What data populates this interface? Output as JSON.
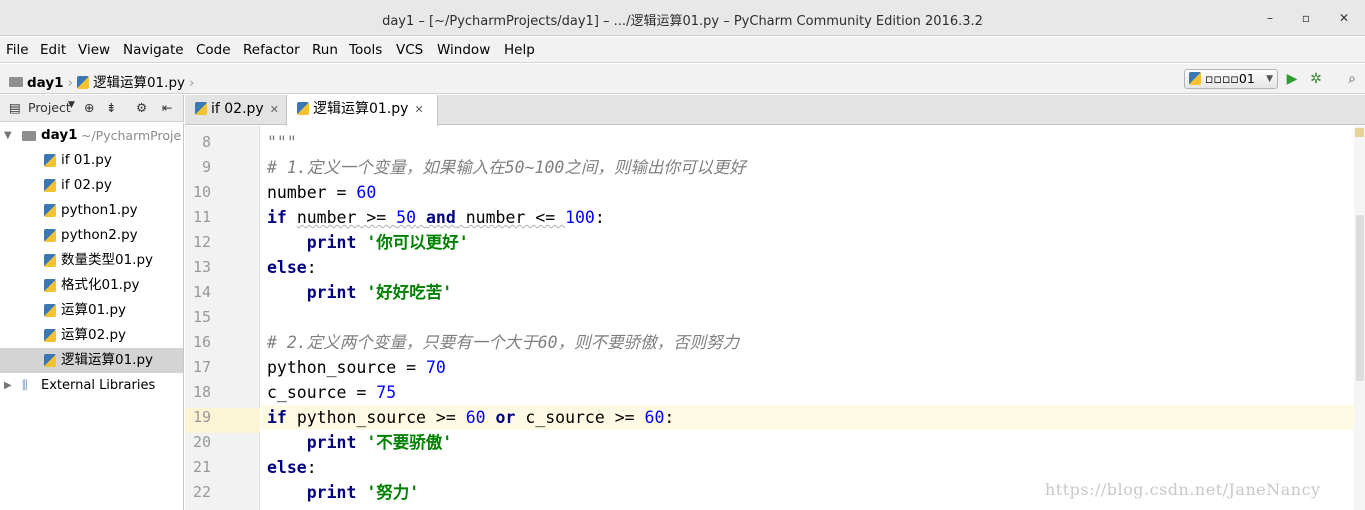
{
  "window": {
    "title": "day1 – [~/PycharmProjects/day1] – .../逻辑运算01.py – PyCharm Community Edition 2016.3.2",
    "minimize": "–",
    "maximize": "▫",
    "close": "✕"
  },
  "menu": [
    "File",
    "Edit",
    "View",
    "Navigate",
    "Code",
    "Refactor",
    "Run",
    "Tools",
    "VCS",
    "Window",
    "Help"
  ],
  "nav": {
    "project": "day1",
    "file": "逻辑运算01.py",
    "run_config": "▫▫▫▫01"
  },
  "project_panel": {
    "label": "Project",
    "root_name": "day1",
    "root_path": "~/PycharmProje",
    "files": [
      "if 01.py",
      "if 02.py",
      "python1.py",
      "python2.py",
      "数量类型01.py",
      "格式化01.py",
      "运算01.py",
      "运算02.py",
      "逻辑运算01.py"
    ],
    "selected_file": "逻辑运算01.py",
    "external": "External Libraries"
  },
  "tabs": [
    {
      "label": "if 02.py",
      "active": false
    },
    {
      "label": "逻辑运算01.py",
      "active": true
    }
  ],
  "editor": {
    "line_numbers": [
      "8",
      "9",
      "10",
      "11",
      "12",
      "13",
      "14",
      "15",
      "16",
      "17",
      "18",
      "19",
      "20",
      "21",
      "22"
    ],
    "current_line": "19",
    "lines": {
      "l8": "\"\"\"",
      "l9": "# 1.定义一个变量，如果输入在50~100之间，则输出你可以更好",
      "l10_a": "number = ",
      "l10_b": "60",
      "l11_kw": "if",
      "l11_a": "number >= ",
      "l11_n1": "50",
      "l11_and": "and",
      "l11_b": "number <= ",
      "l11_n2": "100",
      "l11_c": ":",
      "l12_kw": "print",
      "l12_s": "'你可以更好'",
      "l13_kw": "else",
      "l13_c": ":",
      "l14_kw": "print",
      "l14_s": "'好好吃苦'",
      "l16": "# 2.定义两个变量，只要有一个大于60，则不要骄傲，否则努力",
      "l17_a": "python_source = ",
      "l17_b": "70",
      "l18_a": "c_source = ",
      "l18_b": "75",
      "l19_kw": "if",
      "l19_a": "python_source >= ",
      "l19_n1": "60",
      "l19_or": "or",
      "l19_b": "c_source >= ",
      "l19_n2": "60",
      "l19_c": ":",
      "l20_kw": "print",
      "l20_s": "'不要骄傲'",
      "l21_kw": "else",
      "l21_c": ":",
      "l22_kw": "print",
      "l22_s": "'努力'"
    }
  },
  "watermark": "https://blog.csdn.net/JaneNancy"
}
